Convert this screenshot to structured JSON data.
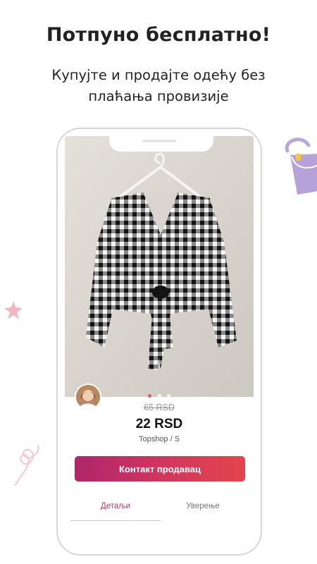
{
  "headline": "Потпуно бесплатно!",
  "subheadline": "Купујте и продајте одећу без плаћања провизије",
  "listing": {
    "old_price": "65 RSD",
    "price": "22 RSD",
    "brand_size": "Topshop / S",
    "contact_button": "Контакт продавац",
    "photo_dots": {
      "count": 3,
      "active": 1
    }
  },
  "tabs": [
    {
      "label": "Детаљи",
      "active": true
    },
    {
      "label": "Уверење",
      "active": false
    }
  ],
  "colors": {
    "accent": "#c0306e",
    "button_start": "#b0266b",
    "button_end": "#e2454a",
    "dot_active": "#e8567a"
  },
  "icons": [
    "handbag-decoration",
    "star-decoration",
    "swirl-decoration"
  ]
}
